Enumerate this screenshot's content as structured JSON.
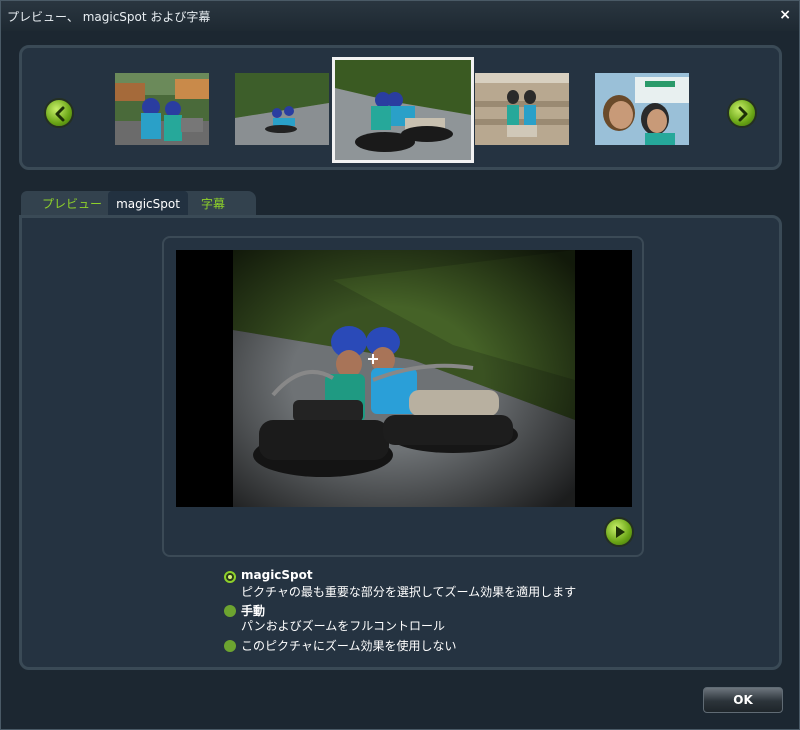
{
  "window": {
    "title": "プレビュー、 magicSpot および字幕",
    "close_label": "×"
  },
  "filmstrip": {
    "prev_icon": "chevron-left-icon",
    "next_icon": "chevron-right-icon",
    "thumbnails": [
      {
        "subject": "couple-selfie-outdoors"
      },
      {
        "subject": "luge-ride-distant"
      },
      {
        "subject": "luge-ride-closeup",
        "selected": true
      },
      {
        "subject": "couple-on-bench"
      },
      {
        "subject": "couple-selfie-closeup"
      }
    ]
  },
  "tabs": {
    "preview": "プレビュー",
    "magicspot": "magicSpot",
    "subtitles": "字幕",
    "active": "magicspot"
  },
  "preview": {
    "play_icon": "play-icon",
    "crosshair_icon": "crosshair-icon"
  },
  "options": {
    "magicspot": {
      "title": "magicSpot",
      "desc": "ピクチャの最も重要な部分を選択してズーム効果を適用します",
      "checked": true
    },
    "manual": {
      "title": "手動",
      "desc": "パンおよびズームをフルコントロール"
    },
    "none": {
      "title": "このピクチャにズーム効果を使用しない"
    }
  },
  "footer": {
    "ok_label": "OK"
  },
  "colors": {
    "accent_green": "#8ed12a",
    "background": "#1c2731",
    "panel": "#253341"
  }
}
